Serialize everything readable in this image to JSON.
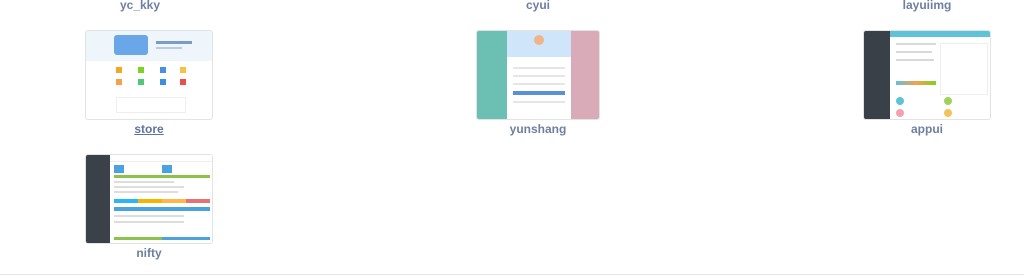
{
  "top_row": {
    "left": "yc_kky",
    "center": "cyui",
    "right": "layuiimg"
  },
  "items": [
    {
      "label": "store",
      "link": true
    },
    {
      "label": "yunshang",
      "link": false
    },
    {
      "label": "appui",
      "link": false
    },
    {
      "label": "nifty",
      "link": false
    }
  ],
  "colors": {
    "label": "#6f7f9f",
    "link": "#5f73a3",
    "border": "#e3e3e3"
  }
}
